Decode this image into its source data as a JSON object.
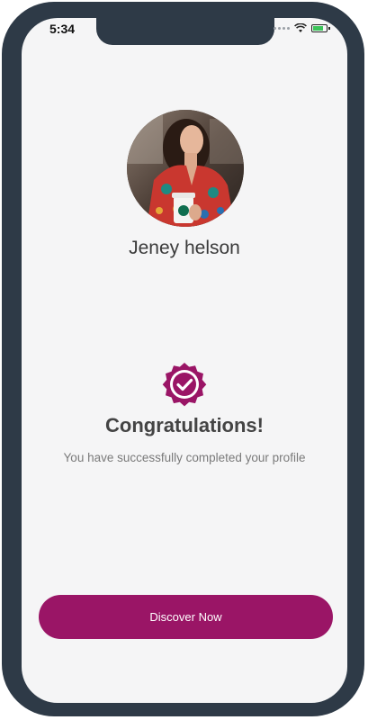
{
  "status_bar": {
    "time": "5:34",
    "icons": [
      "signal-icon",
      "wifi-icon",
      "battery-icon"
    ]
  },
  "profile": {
    "name": "Jeney helson",
    "avatar_icon": "profile-photo"
  },
  "success": {
    "badge_icon": "verified-badge-icon",
    "title": "Congratulations!",
    "subtitle": "You have successfully completed your profile"
  },
  "actions": {
    "discover_label": "Discover Now"
  },
  "colors": {
    "accent": "#9a1566",
    "frame": "#2e3a47",
    "background": "#f5f5f6"
  }
}
